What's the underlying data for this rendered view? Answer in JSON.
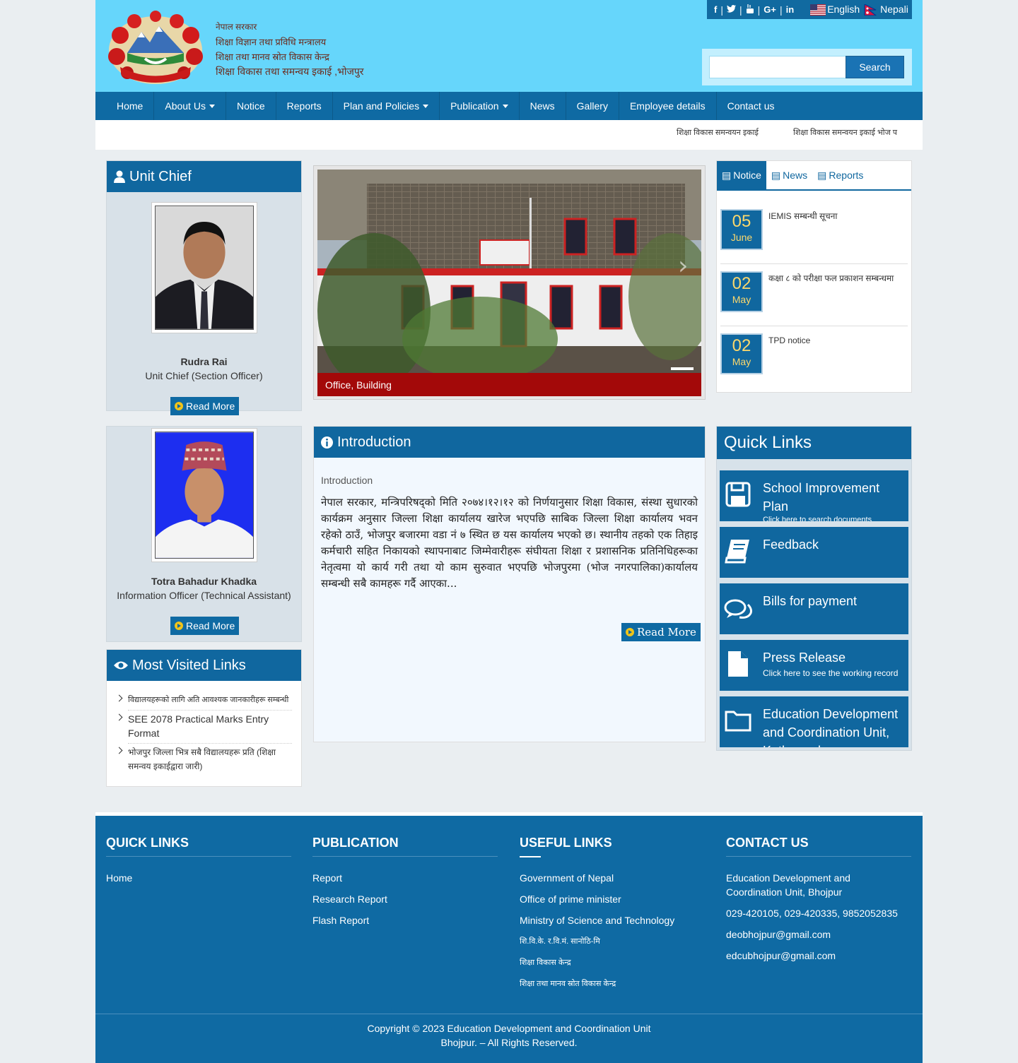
{
  "header": {
    "org_lines": [
      "नेपाल सरकार",
      "शिक्षा विज्ञान तथा प्रविधि मन्त्रालय",
      "शिक्षा तथा मानव स्रोत विकास केन्द्र",
      "शिक्षा विकास तथा समन्वय इकाई ,भोजपुर"
    ],
    "lang_english": "English",
    "lang_nepali": "Nepali",
    "search_button": "Search",
    "search_placeholder": ""
  },
  "nav": {
    "items": [
      "Home",
      "About Us",
      "Notice",
      "Reports",
      "Plan and Policies",
      "Publication",
      "News",
      "Gallery",
      "Employee details",
      "Contact us"
    ]
  },
  "ticker": [
    "शिक्षा विकास समन्वयन इकाई",
    "शिक्षा विकास समन्वयन इकाई भोज प"
  ],
  "unit_chief": {
    "title": "Unit Chief",
    "name": "Rudra Rai",
    "role": "Unit Chief (Section Officer)",
    "read_more": "Read More"
  },
  "info_officer": {
    "name": "Totra Bahadur Khadka",
    "role": "Information Officer (Technical Assistant)",
    "read_more": "Read More"
  },
  "slider": {
    "caption": "Office, Building"
  },
  "tabs": {
    "notice": "Notice",
    "news": "News",
    "reports": "Reports",
    "items": [
      {
        "day": "05",
        "month": "June",
        "title": "IEMIS सम्बन्धी सूचना"
      },
      {
        "day": "02",
        "month": "May",
        "title": "कक्षा ८ को परीक्षा फल प्रकाशन सम्बन्धमा"
      },
      {
        "day": "02",
        "month": "May",
        "title": "TPD notice"
      }
    ]
  },
  "intro": {
    "title": "Introduction",
    "subtitle": "Introduction",
    "text": "नेपाल सरकार, मन्त्रिपरिषद्को मिति २०७४।१२।१२ को निर्णयानुसार शिक्षा विकास, संस्था सुधारको कार्यक्रम अनुसार जिल्ला शिक्षा कार्यालय खारेज भएपछि साबिक जिल्ला शिक्षा कार्यालय भवन रहेको ठाउँ, भोजपुर बजारमा वडा नं ७ स्थित छ यस कार्यालय भएको छ। स्थानीय तहको एक तिहाइ कर्मचारी सहित निकायको स्थापनाबाट जिम्मेवारीहरू संघीयता शिक्षा र प्रशासनिक प्रतिनिधिहरूका नेतृत्वमा यो कार्य गरी तथा यो काम सुरुवात भएपछि भोजपुरमा (भोज नगरपालिका)कार्यालय सम्बन्धी सबै कामहरू गर्दै आएका...",
    "read_more": "Read More"
  },
  "quick_links": {
    "title": "Quick Links",
    "items": [
      {
        "title": "School Improvement Plan",
        "sub": "Click here to search documents",
        "icon": "save-icon"
      },
      {
        "title": "Feedback",
        "sub": "",
        "icon": "book-icon"
      },
      {
        "title": "Bills for payment",
        "sub": "",
        "icon": "comments-icon"
      },
      {
        "title": "Press Release",
        "sub": "Click here to see the working record",
        "icon": "file-icon"
      },
      {
        "title": "Education Development and Coordination Unit, Kathmandu",
        "sub": "",
        "icon": "folder-icon"
      }
    ]
  },
  "most_visited": {
    "title": "Most Visited Links",
    "items": [
      "विद्यालयहरूको लागि अति आवश्यक जानकारीहरू सम्बन्धी",
      "SEE 2078 Practical Marks Entry Format",
      "भोजपुर जिल्ला भित्र सबै विद्यालयहरू प्रति (शिक्षा समन्वय इकाईद्वारा जारी)"
    ]
  },
  "footer": {
    "quick_links_title": "QUICK LINKS",
    "quick_links": [
      "Home"
    ],
    "publication_title": "PUBLICATION",
    "publication": [
      "Report",
      "Research Report",
      "Flash Report"
    ],
    "useful_title": "USEFUL LINKS",
    "useful": [
      "Government of Nepal",
      "Office of prime minister",
      "Ministry of Science and Technology",
      "शि.वि.के. र.वि.मं. सानोठि-मि",
      "शिक्षा विकास केन्द्र",
      "शिक्षा तथा मानव स्रोत विकास केन्द्र"
    ],
    "contact_title": "CONTACT US",
    "contact": [
      " Education Development and Coordination Unit, Bhojpur",
      "029-420105, 029-420335, 9852052835",
      "deobhojpur@gmail.com",
      "edcubhojpur@gmail.com"
    ],
    "copyright_1": "Copyright © 2023 Education Development and Coordination Unit",
    "copyright_2": "Bhojpur. – All Rights Reserved."
  }
}
